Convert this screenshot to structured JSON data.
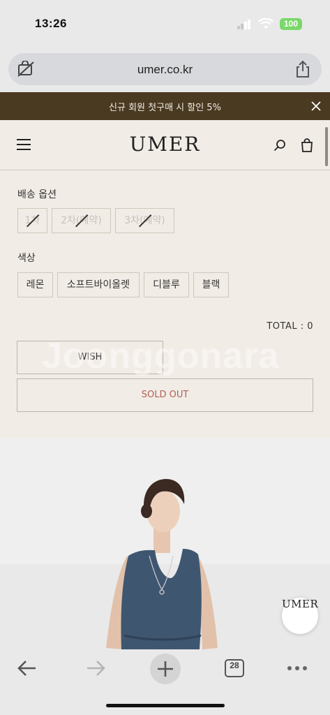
{
  "status_bar": {
    "time": "13:26",
    "battery": "100"
  },
  "browser": {
    "url": "umer.co.kr",
    "tab_count": "28"
  },
  "promo": {
    "text": "신규 회원 첫구매 시 할인 5%"
  },
  "header": {
    "logo": "UMER"
  },
  "delivery": {
    "label": "배송 옵션",
    "options": [
      {
        "label": "1차",
        "disabled": true
      },
      {
        "label": "2차(예약)",
        "disabled": true
      },
      {
        "label": "3차(예약)",
        "disabled": true
      }
    ]
  },
  "color": {
    "label": "색상",
    "options": [
      {
        "label": "레몬"
      },
      {
        "label": "소프트바이올렛"
      },
      {
        "label": "디블루"
      },
      {
        "label": "블랙"
      }
    ]
  },
  "total": "TOTAL : 0",
  "buttons": {
    "wish": "WISH",
    "sold_out": "SOLD OUT"
  },
  "watermark": "Joonggonara",
  "fab": {
    "label": "UMER"
  },
  "colors": {
    "promo_bg": "#4a3a22",
    "page_bg": "#f1ece6",
    "sold_out_text": "#b06258",
    "dress": "#3f5670"
  }
}
